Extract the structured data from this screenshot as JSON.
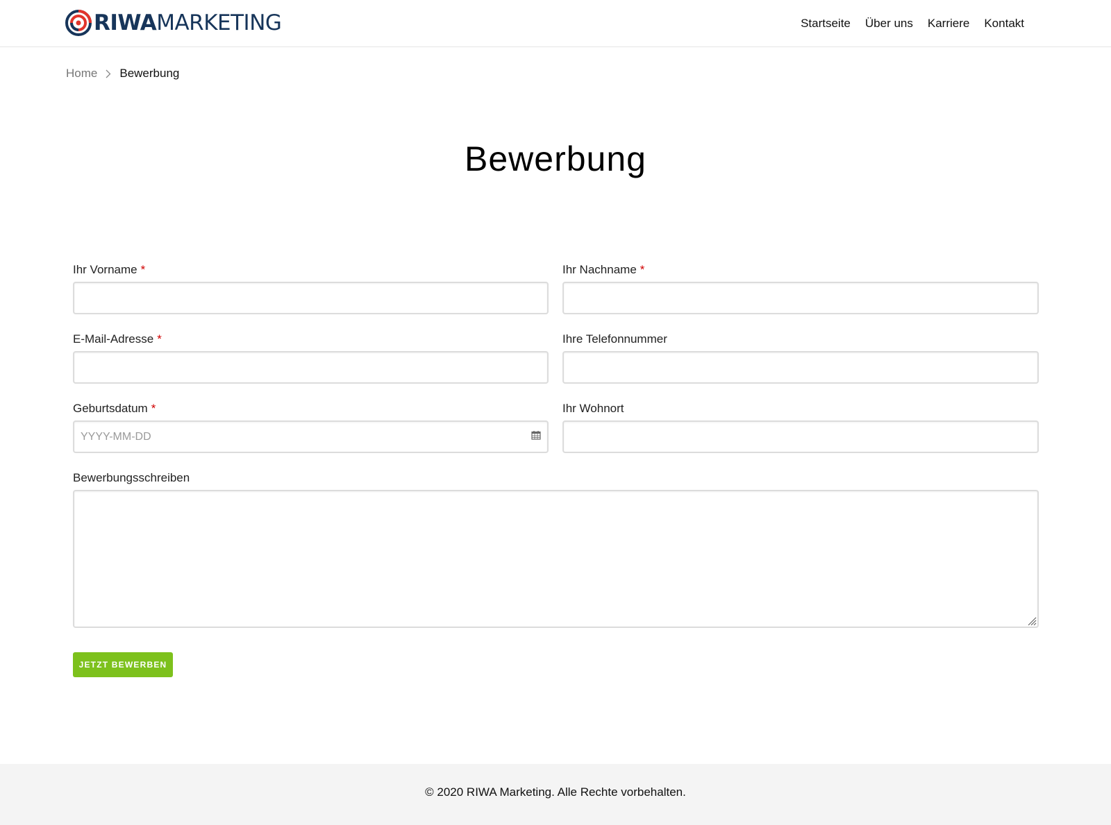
{
  "brand": {
    "name_bold": "RIWA",
    "name_light": "MARKETING",
    "colors": {
      "navy": "#17355a",
      "red": "#e2342b",
      "accent_green": "#7dc11c",
      "required": "#d00000"
    }
  },
  "nav": {
    "items": [
      {
        "label": "Startseite"
      },
      {
        "label": "Über uns"
      },
      {
        "label": "Karriere"
      },
      {
        "label": "Kontakt"
      }
    ]
  },
  "breadcrumb": {
    "home": "Home",
    "separator_icon": "chevron-right-icon",
    "current": "Bewerbung"
  },
  "page": {
    "title": "Bewerbung"
  },
  "form": {
    "required_marker": "*",
    "first_name": {
      "label": "Ihr Vorname",
      "value": "",
      "required": true
    },
    "last_name": {
      "label": "Ihr Nachname",
      "value": "",
      "required": true
    },
    "email": {
      "label": "E-Mail-Adresse",
      "value": "",
      "required": true
    },
    "phone": {
      "label": "Ihre Telefonnummer",
      "value": "",
      "required": false
    },
    "birthdate": {
      "label": "Geburtsdatum",
      "placeholder": "YYYY-MM-DD",
      "value": "",
      "required": true,
      "icon": "calendar-icon"
    },
    "city": {
      "label": "Ihr Wohnort",
      "value": "",
      "required": false
    },
    "cover_letter": {
      "label": "Bewerbungsschreiben",
      "value": ""
    },
    "submit_label": "JETZT BEWERBEN"
  },
  "footer": {
    "copyright": "© 2020 RIWA Marketing. Alle Rechte vorbehalten."
  }
}
